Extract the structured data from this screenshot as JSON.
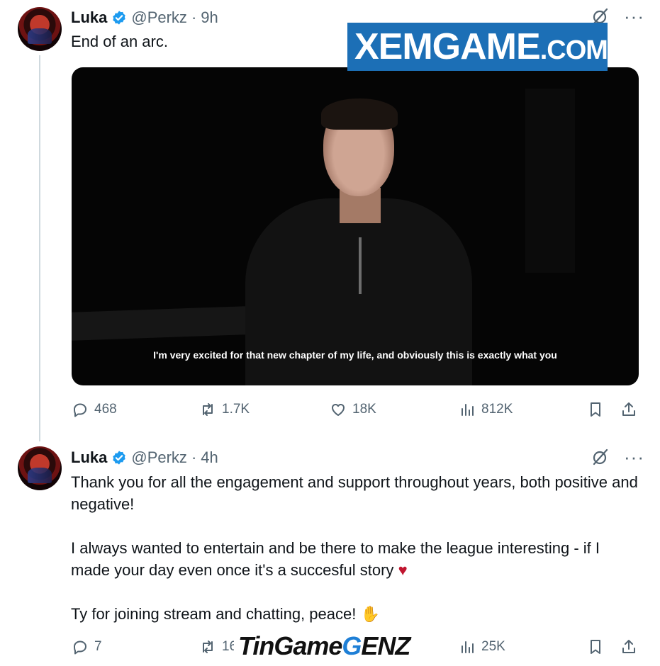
{
  "tweets": [
    {
      "name": "Luka",
      "handle": "@Perkz",
      "dot": "·",
      "time": "9h",
      "text": "End of an arc.",
      "video_subtitle": "I'm very excited for that new chapter of my life, and obviously this is exactly what you",
      "stats": {
        "replies": "468",
        "retweets": "1.7K",
        "likes": "18K",
        "views": "812K"
      }
    },
    {
      "name": "Luka",
      "handle": "@Perkz",
      "dot": "·",
      "time": "4h",
      "paragraphs": [
        "Thank you for all the engagement and support throughout years, both positive and negative!",
        "I always wanted to entertain and be there to make the league interesting - if I made your day even once it's a succesful story",
        "Ty for joining stream and chatting, peace!"
      ],
      "emoji": {
        "heart": "♥",
        "hand": "✋"
      },
      "stats": {
        "replies": "7",
        "retweets": "16",
        "views": "25K"
      }
    }
  ],
  "more_label": "···",
  "watermarks": {
    "top": {
      "main": "XEMGAME",
      "suffix": ".COM"
    },
    "bottom": {
      "part1": "TinGame",
      "part2": "G",
      "part3": "ENZ"
    }
  },
  "colors": {
    "verified": "#1d9bf0",
    "muted": "#536471",
    "watermark_blue": "#1c6fb6"
  }
}
